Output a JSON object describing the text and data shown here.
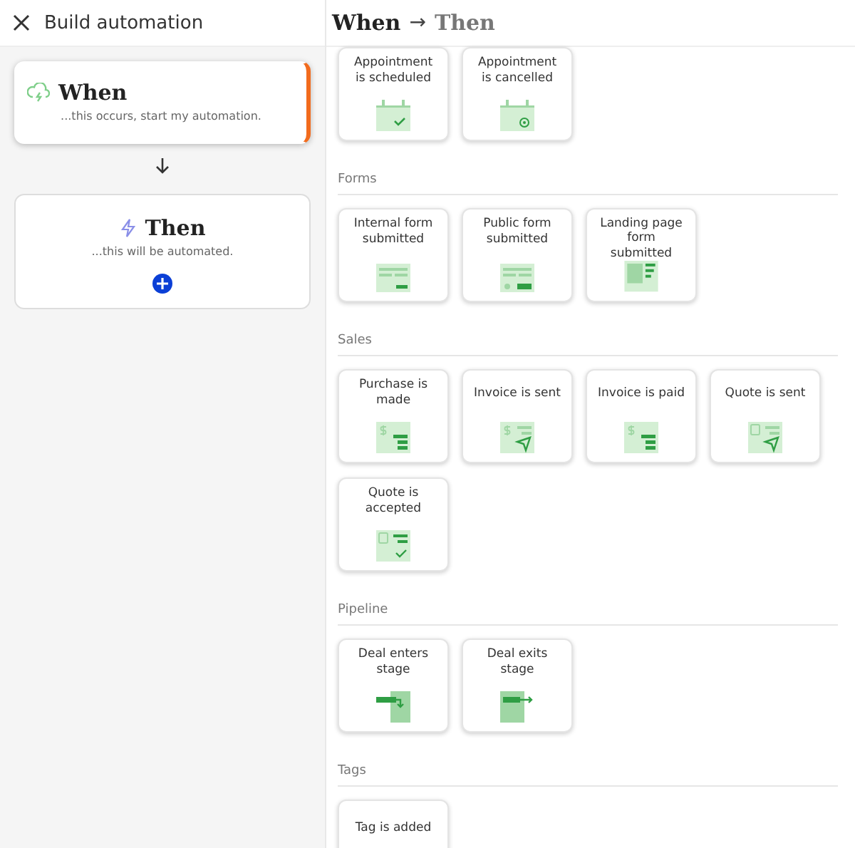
{
  "sidebar": {
    "title": "Build automation",
    "steps": [
      {
        "kind": "when",
        "title": "When",
        "subtitle": "...this occurs, start my automation.",
        "selected": true
      },
      {
        "kind": "then",
        "title": "Then",
        "subtitle": "...this will be automated.",
        "selected": false
      }
    ]
  },
  "header": {
    "first": "When",
    "arrow": "→",
    "second": "Then"
  },
  "sections": [
    {
      "cards": [
        {
          "label": "Appointment is scheduled",
          "kind": "calendar-check"
        },
        {
          "label": "Appointment is cancelled",
          "kind": "calendar-x"
        }
      ]
    },
    {
      "title": "Forms",
      "cards": [
        {
          "label": "Internal form submitted",
          "kind": "form"
        },
        {
          "label": "Public form submitted",
          "kind": "form-public"
        },
        {
          "label": "Landing page form submitted",
          "kind": "landing"
        }
      ]
    },
    {
      "title": "Sales",
      "cards": [
        {
          "label": "Purchase is made",
          "kind": "purchase"
        },
        {
          "label": "Invoice is sent",
          "kind": "invoice-sent"
        },
        {
          "label": "Invoice is paid",
          "kind": "invoice-paid"
        },
        {
          "label": "Quote is sent",
          "kind": "quote-sent"
        },
        {
          "label": "Quote is accepted",
          "kind": "quote-accepted"
        }
      ]
    },
    {
      "title": "Pipeline",
      "cards": [
        {
          "label": "Deal enters stage",
          "kind": "deal-enter"
        },
        {
          "label": "Deal exits stage",
          "kind": "deal-exit"
        }
      ]
    },
    {
      "title": "Tags",
      "cards": [
        {
          "label": "Tag is added",
          "kind": "none"
        }
      ]
    }
  ]
}
